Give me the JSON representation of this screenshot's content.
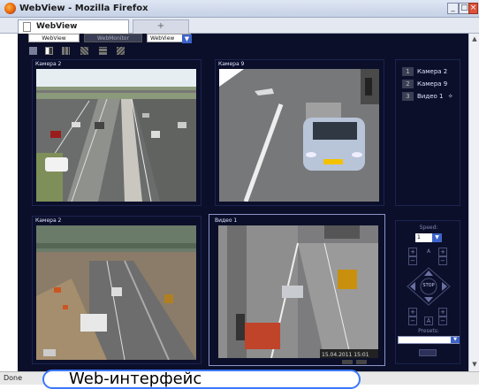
{
  "window": {
    "title": "WebView - Mozilla Firefox"
  },
  "tabs": {
    "active": "WebView",
    "new": "+"
  },
  "toolbar": {
    "webview": "WebView",
    "webmonitor": "WebMonitor",
    "select": "WebView"
  },
  "panels": [
    {
      "label": "Камера 2"
    },
    {
      "label": "Камера 9"
    },
    {
      "label": "Камера 2"
    },
    {
      "label": "Видео 1"
    }
  ],
  "sidebar": {
    "items": [
      {
        "num": "1",
        "label": "Камера 2"
      },
      {
        "num": "2",
        "label": "Камера 9"
      },
      {
        "num": "3",
        "label": "Видео 1"
      }
    ]
  },
  "controls": {
    "speed_label": "Speed:",
    "speed_value": "1",
    "zoom_label": "A",
    "stop_label": "STOP",
    "presets_label": "Presets:"
  },
  "status": {
    "text": "Done"
  },
  "caption": {
    "text": "Web-интерфейс"
  },
  "video_timestamp": "15.04.2011 15:01",
  "colors": {
    "background": "#0b0f2a",
    "panel_border": "#1c2450",
    "highlight": "#3a78ff"
  }
}
